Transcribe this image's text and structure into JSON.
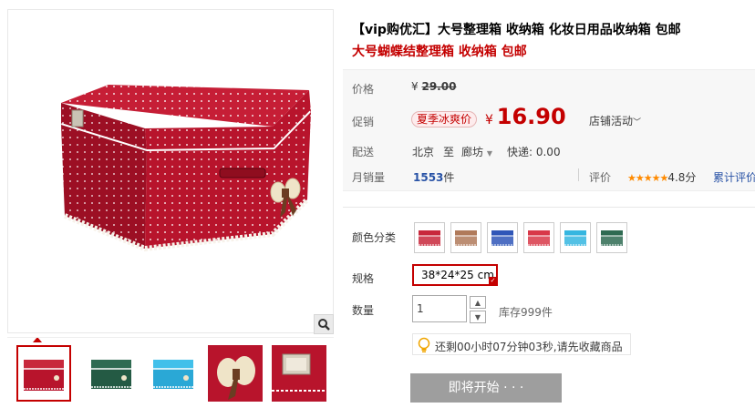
{
  "product": {
    "title": "【vip购优汇】大号整理箱 收纳箱 化妆日用品收纳箱 包邮",
    "subtitle": "大号蝴蝶结整理箱 收纳箱 包邮"
  },
  "price": {
    "label": "价格",
    "currency": "¥",
    "original": "29.00"
  },
  "promo": {
    "label": "促销",
    "tag": "夏季冰爽价",
    "currency": "¥",
    "price": "16.90",
    "store_activity": "店铺活动",
    "store_activity_chevron": "chevron-down-icon"
  },
  "delivery": {
    "label": "配送",
    "from": "北京",
    "to_word": "至",
    "destination": "廊坊",
    "shipping": "快递: 0.00"
  },
  "sales": {
    "label": "月销量",
    "count": "1553",
    "unit": "件",
    "rating_label": "评价",
    "stars": "★★★★★",
    "score": "4.8分",
    "total_reviews_link": "累计评价"
  },
  "color": {
    "label": "颜色分类",
    "swatches": [
      {
        "color": "#c8283c"
      },
      {
        "color": "#b07a5a"
      },
      {
        "color": "#2f56b8"
      },
      {
        "color": "#d83848"
      },
      {
        "color": "#35b6e0"
      },
      {
        "color": "#2f6b52"
      }
    ]
  },
  "spec": {
    "label": "规格",
    "selected": "38*24*25 cm"
  },
  "quantity": {
    "label": "数量",
    "value": "1",
    "stock": "库存999件"
  },
  "notice": {
    "text": "还剩00小时07分钟03秒,请先收藏商品",
    "icon": "lightbulb-icon"
  },
  "buy_button": {
    "label": "即将开始 · · ·"
  },
  "colors": {
    "accent": "#c40000",
    "link": "#2953a6",
    "star": "#ff8a00"
  }
}
